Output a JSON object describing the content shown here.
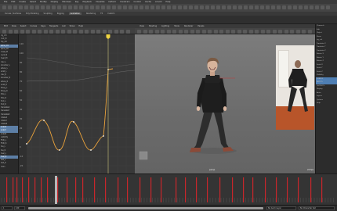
{
  "app": {
    "menus": [
      "File",
      "Edit",
      "Create",
      "Select",
      "Modify",
      "Display",
      "Windows",
      "Key",
      "Playback",
      "Visualize",
      "Deform",
      "Constrain",
      "Control",
      "Cache",
      "Arnold",
      "Help"
    ],
    "shelf_tabs": [
      "Curves / Surfaces",
      "Poly Modeling",
      "Sculpting",
      "Rigging",
      "Animation",
      "Rendering",
      "FX",
      "Custom"
    ],
    "active_shelf": "Animation"
  },
  "graph_editor": {
    "menus": [
      "Edit",
      "View",
      "Select",
      "Curves",
      "Keys",
      "Tangents",
      "List",
      "Show",
      "Help"
    ],
    "outliner_items": [
      "rig_ctrl",
      "root_M",
      "hip_ctrl",
      "spine_01",
      "spine_02",
      "chest_M",
      "neck_M",
      "head_M",
      "clav_L",
      "shoulder_L",
      "elbow_L",
      "wrist_L",
      "clav_R",
      "shoulder_R",
      "elbow_R",
      "wrist_R",
      "IKLeg_L",
      "IKLeg_R",
      "Pole_L",
      "Pole_R",
      "foot_L",
      "foot_R",
      "translateX",
      "translateY",
      "translateZ",
      "rotateX",
      "rotateY",
      "rotateZ",
      "scaleX",
      "scaleY",
      "scaleZ",
      "visibility",
      "FKIK_L",
      "FKIK_R",
      "toe_L",
      "toe_R",
      "heel_L",
      "heel_R",
      "ball_L",
      "ball_R",
      "main"
    ],
    "selected_indices": [
      3,
      28,
      29,
      37
    ],
    "current_frame": 23,
    "y_ticks": [
      "110",
      "100",
      "90",
      "80",
      "70",
      "60",
      "50",
      "40",
      "30",
      "20",
      "10",
      "0",
      "-10",
      "-20"
    ],
    "curve_color": "#e9a23b"
  },
  "viewport": {
    "menus": [
      "View",
      "Shading",
      "Lighting",
      "Show",
      "Renderer",
      "Panels"
    ],
    "camera_label": "persp",
    "fps_label": "24 fps"
  },
  "time_slider": {
    "start": "1",
    "end": "120",
    "current": "23"
  },
  "bottom": {
    "range_start": "1",
    "range_end": "120",
    "anim_layer": "No Anim Layer",
    "char_set": "No Character Set"
  },
  "right_panel": {
    "items": [
      "Channels",
      "Edit",
      "Object",
      "Show",
      "rig_ctrl",
      "Translate X",
      "Translate Y",
      "Translate Z",
      "Rotate X",
      "Rotate Y",
      "Rotate Z",
      "Scale X",
      "Scale Y",
      "Scale Z",
      "Visibility",
      "SHAPES",
      "INPUTS",
      "OUTPUTS",
      "Display",
      "Anim",
      "Layers",
      "Options",
      "Help"
    ]
  },
  "colors": {
    "accent": "#5d7fa6",
    "key_red": "#c8262b",
    "playhead": "#f0d542"
  }
}
